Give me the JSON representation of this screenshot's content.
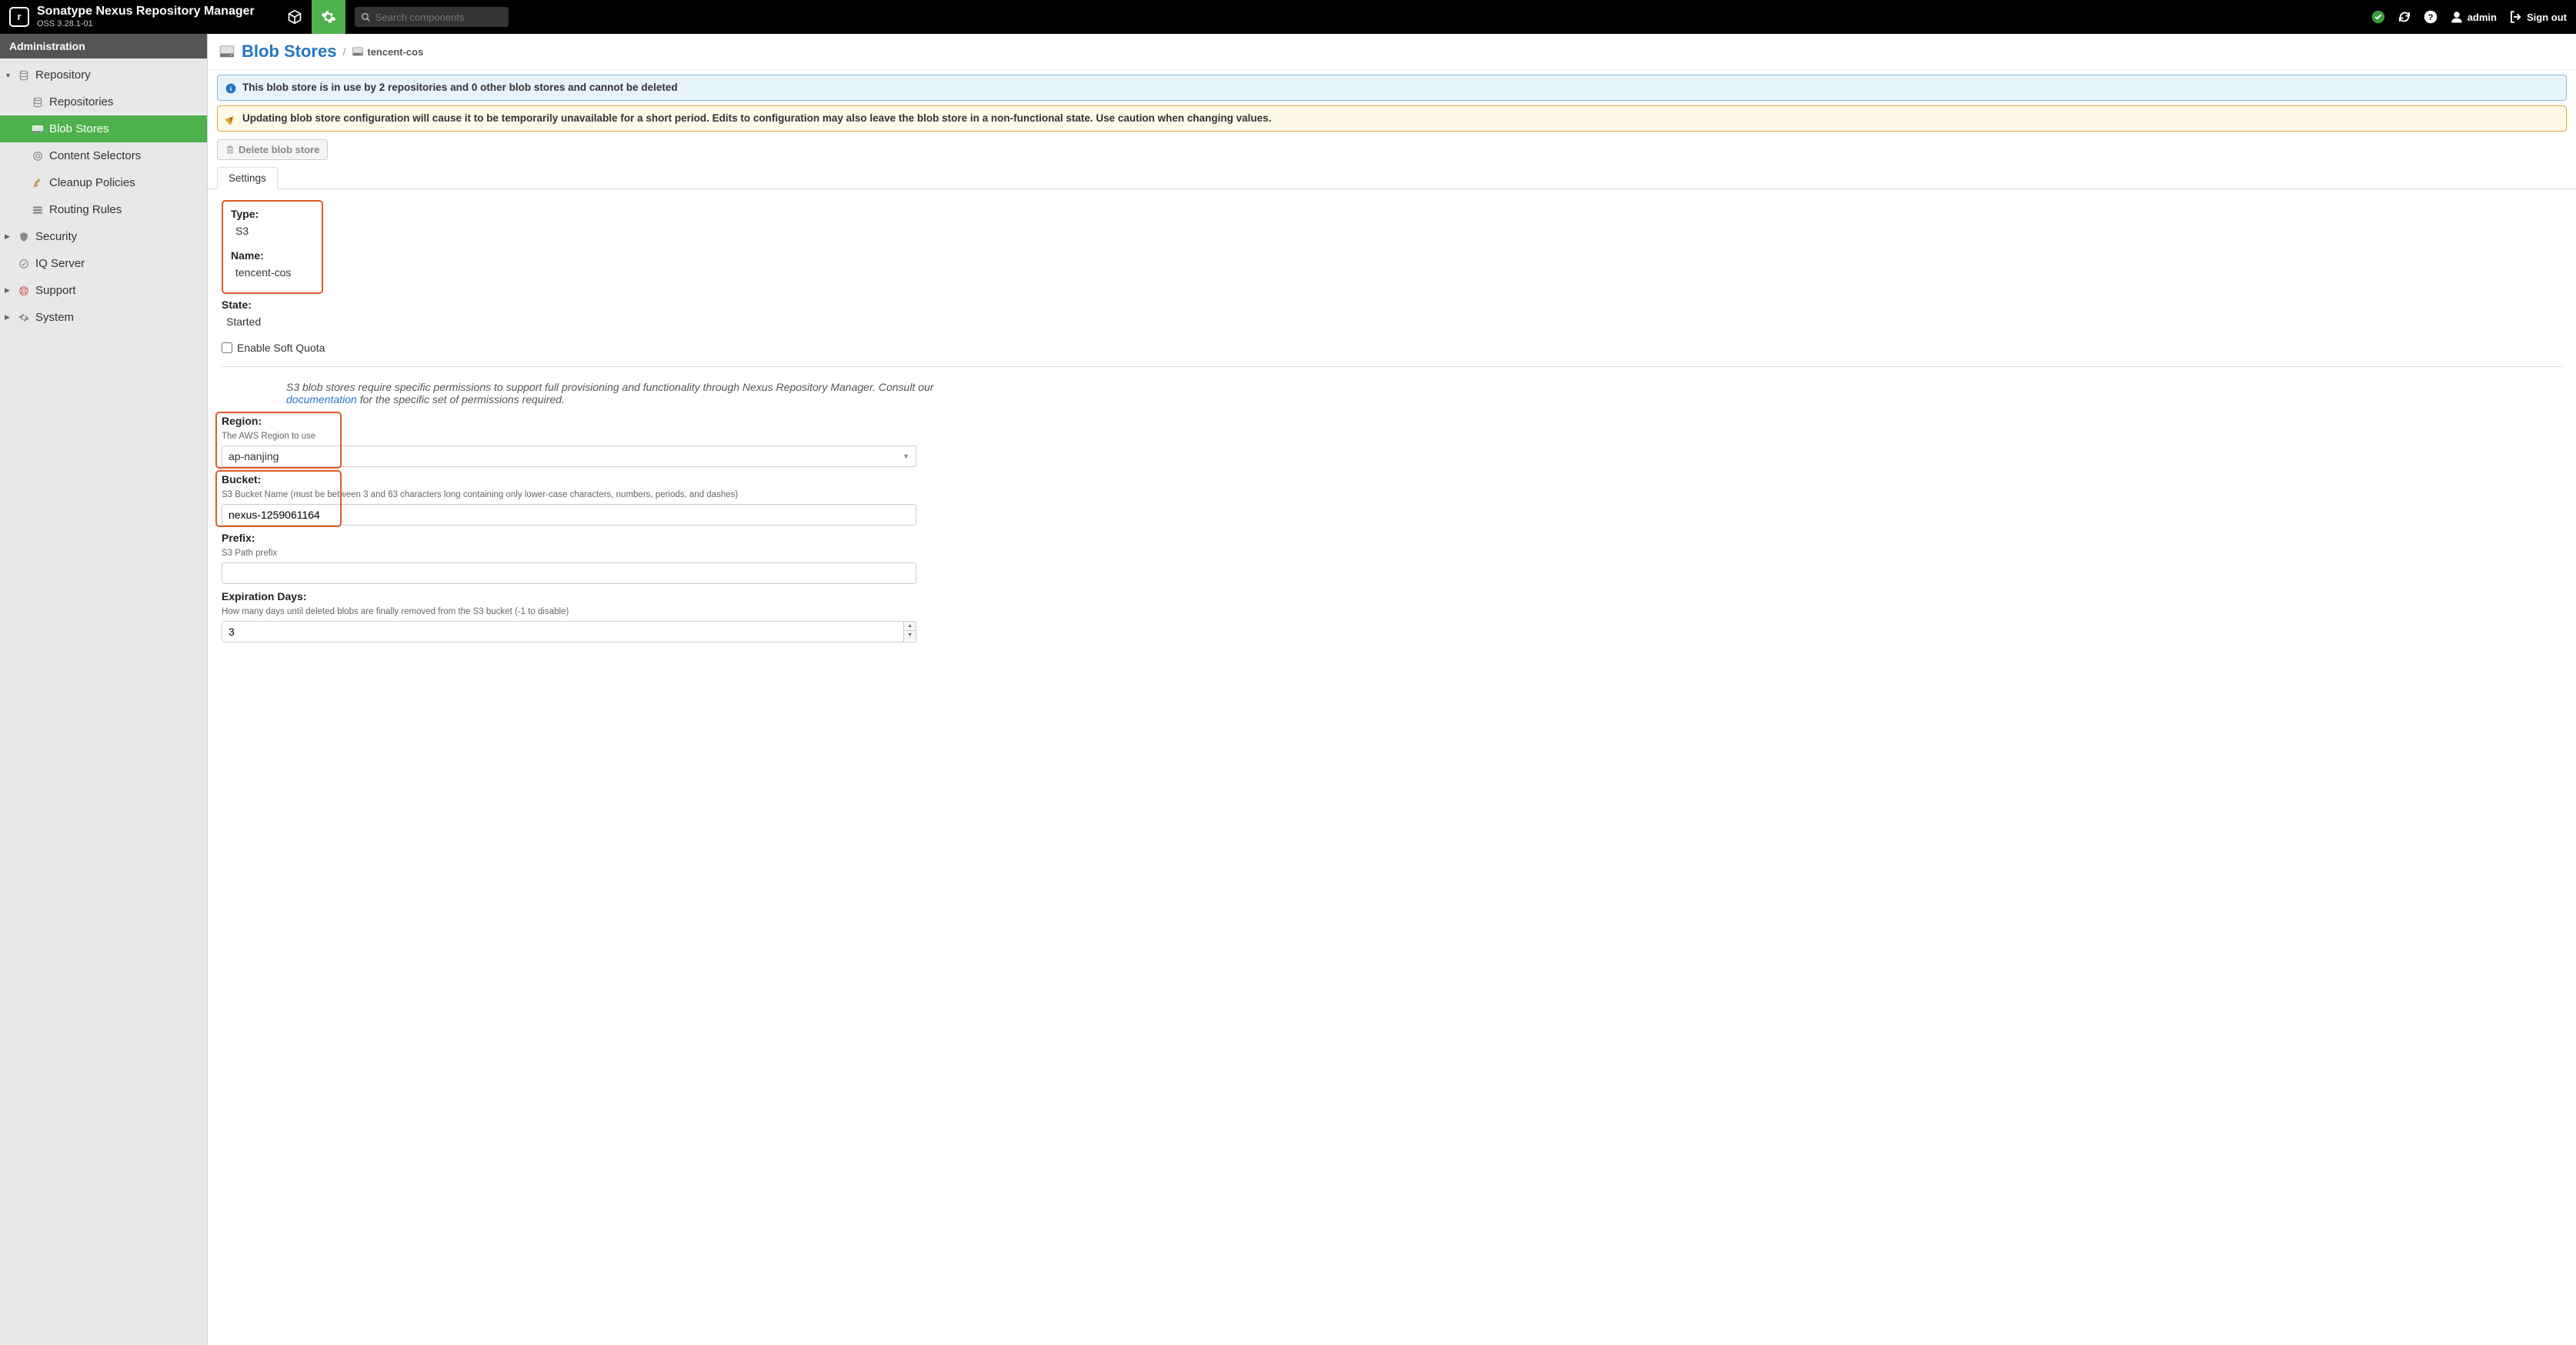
{
  "header": {
    "product_name": "Sonatype Nexus Repository Manager",
    "version": "OSS 3.28.1-01",
    "search_placeholder": "Search components",
    "username": "admin",
    "signout": "Sign out"
  },
  "sidebar": {
    "title": "Administration",
    "groups": [
      {
        "label": "Repository",
        "expanded": true,
        "items": [
          {
            "label": "Repositories"
          },
          {
            "label": "Blob Stores",
            "active": true
          },
          {
            "label": "Content Selectors"
          },
          {
            "label": "Cleanup Policies"
          },
          {
            "label": "Routing Rules"
          }
        ]
      },
      {
        "label": "Security",
        "expanded": false
      },
      {
        "label": "IQ Server",
        "leaf": true
      },
      {
        "label": "Support",
        "expanded": false
      },
      {
        "label": "System",
        "expanded": false
      }
    ]
  },
  "page": {
    "title": "Blob Stores",
    "breadcrumb_item": "tencent-cos",
    "alert_info": "This blob store is in use by 2 repositories and 0 other blob stores and cannot be deleted",
    "alert_warning": "Updating blob store configuration will cause it to be temporarily unavailable for a short period. Edits to configuration may also leave the blob store in a non-functional state. Use caution when changing values.",
    "delete_button": "Delete blob store",
    "tab_settings": "Settings"
  },
  "form": {
    "type_label": "Type:",
    "type_value": "S3",
    "name_label": "Name:",
    "name_value": "tencent-cos",
    "state_label": "State:",
    "state_value": "Started",
    "quota_label": "Enable Soft Quota",
    "info_prefix": "S3 blob stores require specific permissions to support full provisioning and functionality through Nexus Repository Manager. Consult our ",
    "info_link": "documentation",
    "info_suffix": " for the specific set of permissions required.",
    "region_label": "Region:",
    "region_help": "The AWS Region to use",
    "region_value": "ap-nanjing",
    "bucket_label": "Bucket:",
    "bucket_help": "S3 Bucket Name (must be between 3 and 63 characters long containing only lower-case characters, numbers, periods, and dashes)",
    "bucket_value": "nexus-1259061164",
    "prefix_label": "Prefix:",
    "prefix_help": "S3 Path prefix",
    "prefix_value": "",
    "expiration_label": "Expiration Days:",
    "expiration_help": "How many days until deleted blobs are finally removed from the S3 bucket (-1 to disable)",
    "expiration_value": "3"
  }
}
